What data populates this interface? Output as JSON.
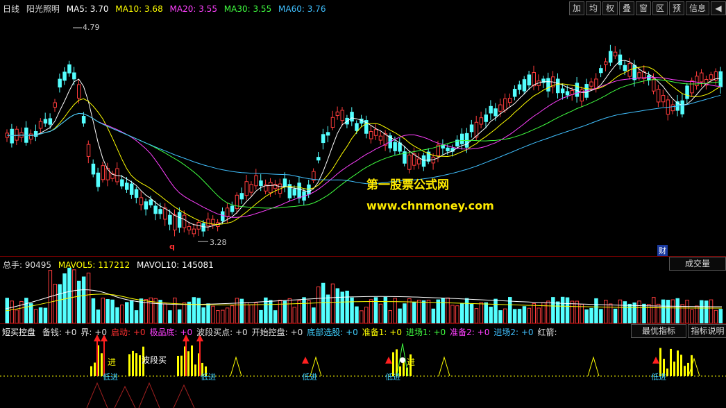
{
  "price_header": {
    "period": "日线",
    "stock_name": "阳光照明",
    "ma5": "MA5: 3.70",
    "ma10": "MA10: 3.68",
    "ma20": "MA20: 3.55",
    "ma30": "MA30: 3.55",
    "ma60": "MA60: 3.76"
  },
  "toolbar": [
    "加",
    "均",
    "权",
    "叠",
    "窗",
    "区",
    "预",
    "信息",
    "◀"
  ],
  "price_labels": {
    "high": "4.79",
    "low": "3.28",
    "marker_q": "q",
    "marker_cai": "财"
  },
  "watermark": {
    "line1": "第一股票公式网",
    "line2": "www.chnmoney.com"
  },
  "volume_header": {
    "total": "总手: 90495",
    "mavol5": "MAVOL5: 117212",
    "mavol10": "MAVOL10: 145081",
    "mode_button": "成交量"
  },
  "indicator_header": {
    "name": "短买控盘",
    "items": [
      {
        "t": "备钱: +0",
        "c": "#e0e0e0"
      },
      {
        "t": "界: +0",
        "c": "#e0e0e0"
      },
      {
        "t": "启动: +0",
        "c": "#ff3030"
      },
      {
        "t": "极品底: +0",
        "c": "#ff40ff"
      },
      {
        "t": "波段买点: +0",
        "c": "#e0e0e0"
      },
      {
        "t": "开始控盘: +0",
        "c": "#e0e0e0"
      },
      {
        "t": "底部选股: +0",
        "c": "#3fd0ff"
      },
      {
        "t": "准备1: +0",
        "c": "#ffff00"
      },
      {
        "t": "进场1: +0",
        "c": "#40ff40"
      },
      {
        "t": "准备2: +0",
        "c": "#ff40ff"
      },
      {
        "t": "进场2: +0",
        "c": "#40c0ff"
      },
      {
        "t": "红箭:",
        "c": "#e0e0e0"
      }
    ],
    "best_button": "最优指标",
    "explain_button": "指标说明"
  },
  "indicator_labels": {
    "jin": "进",
    "di_jin": "低进",
    "bo_duan_mai": "波段买"
  },
  "colors": {
    "up": "#ff3c3c",
    "down": "#54ffff",
    "ma5": "#ffffff",
    "ma10": "#ffff00",
    "ma20": "#ff40ff",
    "ma30": "#40ff40",
    "ma60": "#40c0ff"
  }
}
